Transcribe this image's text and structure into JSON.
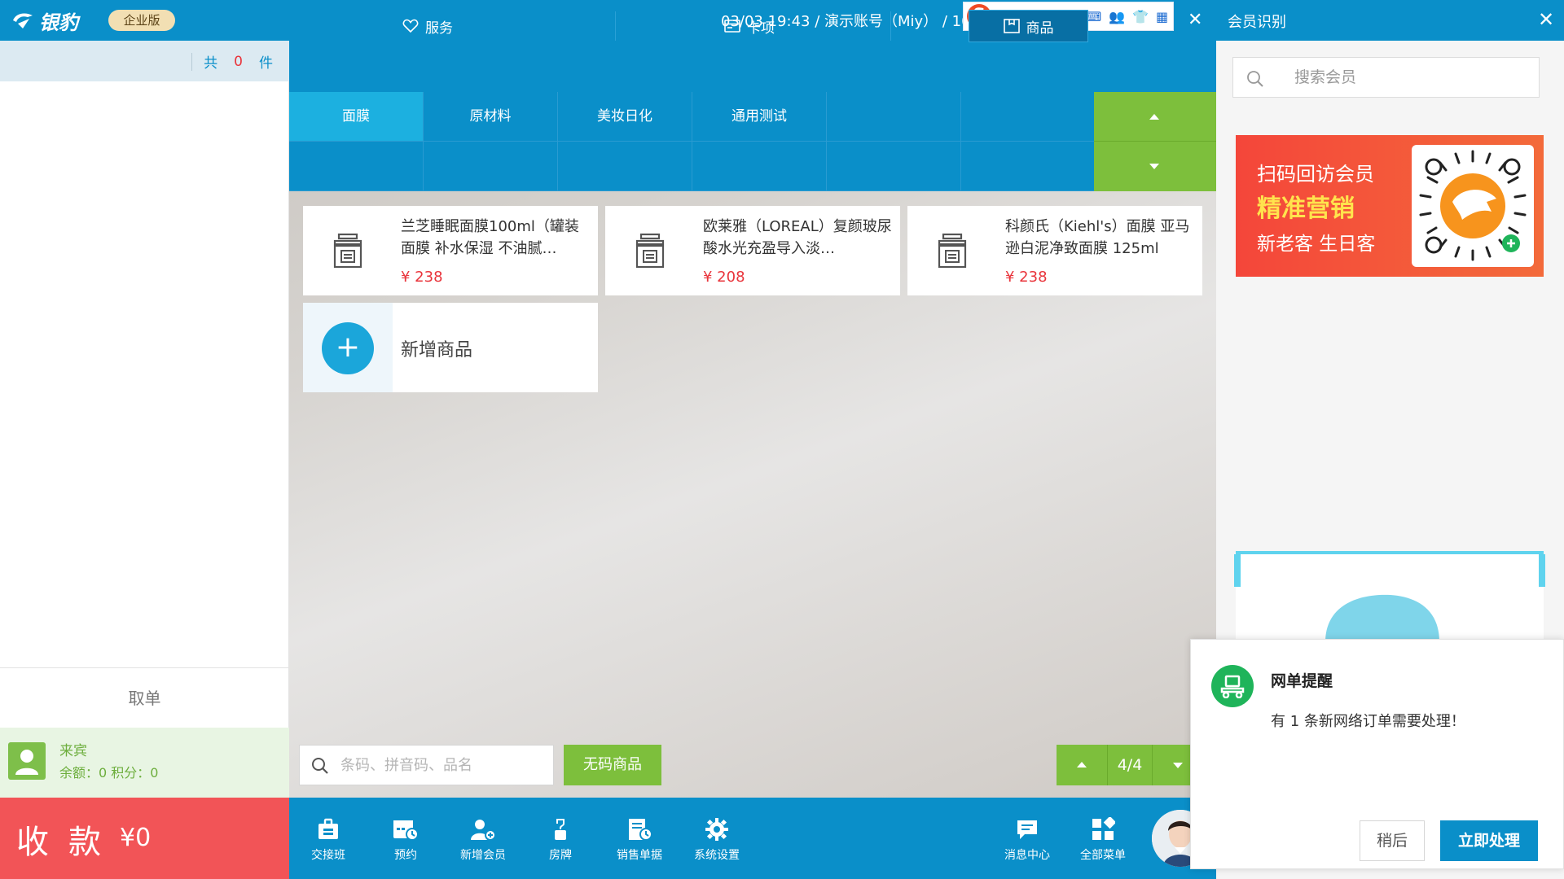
{
  "app": {
    "logo_text": "银豹",
    "edition": "企业版",
    "top_info": "03/03 19:43 / 演示账号（Miy） / 100"
  },
  "ime": {
    "logo": "S",
    "items": [
      "中",
      "°,",
      "☺",
      "🎙",
      "⌨",
      "👥",
      "👕",
      "▦"
    ]
  },
  "cart": {
    "count_prefix": "共",
    "count": "0",
    "count_suffix": "件",
    "take_order": "取单"
  },
  "member": {
    "name": "来宾",
    "balance_line": "余额：0  积分：0"
  },
  "checkout": {
    "label": "收款",
    "amount": "¥0"
  },
  "type_tabs": [
    {
      "label": "服务",
      "icon": "heart-icon"
    },
    {
      "label": "卡项",
      "icon": "card-icon"
    },
    {
      "label": "商品",
      "icon": "box-icon"
    }
  ],
  "categories": [
    "面膜",
    "原材料",
    "美妆日化",
    "通用测试",
    "",
    "",
    "",
    "",
    "",
    "",
    "",
    ""
  ],
  "products": [
    {
      "name": "兰芝睡眠面膜100ml（罐装面膜 补水保湿 不油腻…",
      "price": "¥ 238"
    },
    {
      "name": "欧莱雅（LOREAL）复颜玻尿酸水光充盈导入淡…",
      "price": "¥ 208"
    },
    {
      "name": "科颜氏（Kiehl's）面膜 亚马逊白泥净致面膜 125ml",
      "price": "¥ 238"
    }
  ],
  "add_product": {
    "label": "新增商品"
  },
  "search": {
    "placeholder": "条码、拼音码、品名",
    "no_code_label": "无码商品"
  },
  "pager": {
    "text": "4/4"
  },
  "bottom_menu": [
    {
      "label": "交接班",
      "icon": "shift-icon"
    },
    {
      "label": "预约",
      "icon": "calendar-icon"
    },
    {
      "label": "新增会员",
      "icon": "add-user-icon"
    },
    {
      "label": "房牌",
      "icon": "room-tag-icon"
    },
    {
      "label": "销售单据",
      "icon": "receipt-icon"
    },
    {
      "label": "系统设置",
      "icon": "gear-icon"
    },
    {
      "label": "消息中心",
      "icon": "message-icon"
    },
    {
      "label": "全部菜单",
      "icon": "grid-icon"
    }
  ],
  "right_panel": {
    "title": "会员识别",
    "search_placeholder": "搜索会员",
    "banner": {
      "line1": "扫码回访会员",
      "line2": "精准营销",
      "line3": "新老客 生日客"
    }
  },
  "notification": {
    "title": "网单提醒",
    "message": "有 1 条新网络订单需要处理！",
    "later_label": "稍后",
    "handle_label": "立即处理"
  },
  "colors": {
    "primary": "#0a8fc9",
    "green": "#7dbf3c",
    "red": "#f25457",
    "price": "#e9343b"
  }
}
